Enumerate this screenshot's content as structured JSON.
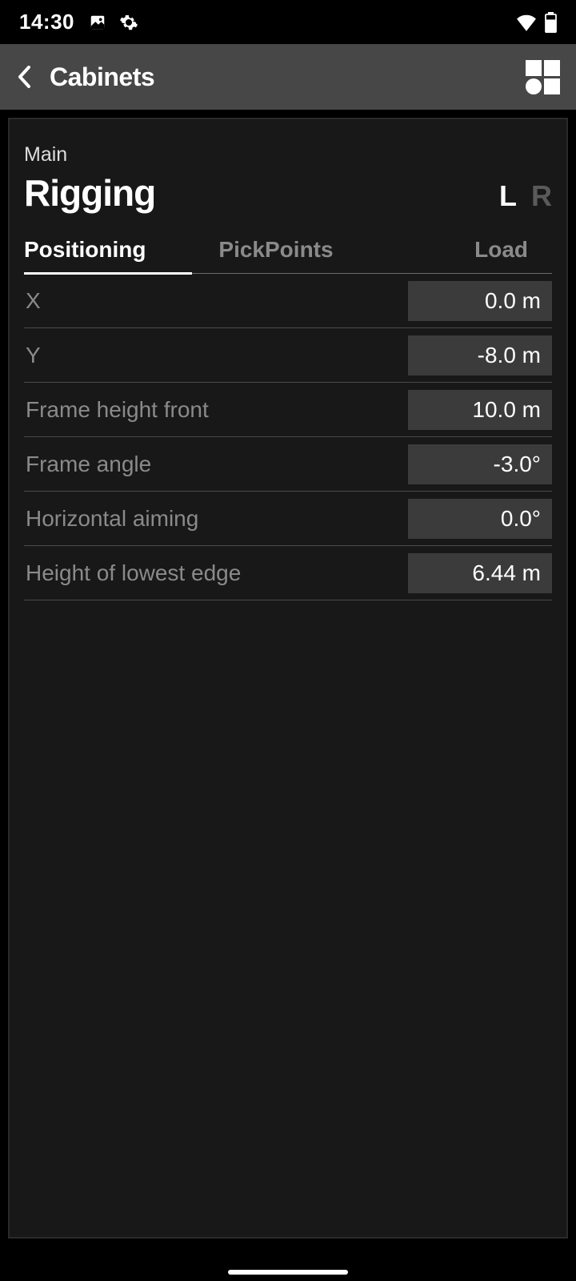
{
  "statusbar": {
    "time": "14:30"
  },
  "appbar": {
    "title": "Cabinets"
  },
  "panel": {
    "subtitle": "Main",
    "title": "Rigging",
    "lr": {
      "left": "L",
      "right": "R",
      "active": "L"
    },
    "tabs": [
      {
        "label": "Positioning",
        "active": true
      },
      {
        "label": "PickPoints",
        "active": false
      },
      {
        "label": "Load",
        "active": false
      }
    ],
    "params": [
      {
        "label": "X",
        "value": "0.0 m"
      },
      {
        "label": "Y",
        "value": "-8.0 m"
      },
      {
        "label": "Frame height front",
        "value": "10.0 m"
      },
      {
        "label": "Frame angle",
        "value": "-3.0°"
      },
      {
        "label": "Horizontal aiming",
        "value": "0.0°"
      },
      {
        "label": "Height of lowest edge",
        "value": "6.44 m"
      }
    ]
  }
}
